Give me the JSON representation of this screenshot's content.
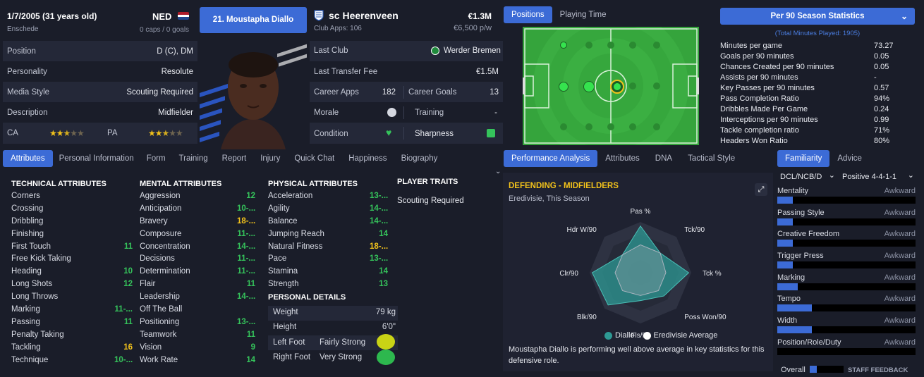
{
  "header": {
    "dob": "1/7/2005 (31 years old)",
    "birthplace": "Enschede",
    "nation": "NED",
    "caps": "0 caps / 0 goals",
    "player_button": "21. Moustapha Diallo",
    "club": "sc Heerenveen",
    "club_apps": "Club Apps: 106",
    "value": "€1.3M",
    "wage": "€6,500 p/w"
  },
  "profile": [
    {
      "label": "Position",
      "value": "D (C), DM"
    },
    {
      "label": "Personality",
      "value": "Resolute"
    },
    {
      "label": "Media Style",
      "value": "Scouting Required"
    },
    {
      "label": "Description",
      "value": "Midfielder"
    }
  ],
  "ca_label": "CA",
  "pa_label": "PA",
  "ca_stars": 2.5,
  "pa_stars": 2.5,
  "career": {
    "last_club_label": "Last Club",
    "last_club": "Werder Bremen",
    "transfer_fee_label": "Last Transfer Fee",
    "transfer_fee": "€1.5M",
    "career_apps_label": "Career Apps",
    "career_apps": "182",
    "career_goals_label": "Career Goals",
    "career_goals": "13",
    "morale_label": "Morale",
    "training_label": "Training",
    "training": "-",
    "condition_label": "Condition",
    "sharpness_label": "Sharpness"
  },
  "left_tabs": [
    "Attributes",
    "Personal Information",
    "Form",
    "Training",
    "Report",
    "Injury",
    "Quick Chat",
    "Happiness",
    "Biography"
  ],
  "technical": {
    "title": "TECHNICAL ATTRIBUTES",
    "rows": [
      {
        "name": "Corners",
        "value": ""
      },
      {
        "name": "Crossing",
        "value": ""
      },
      {
        "name": "Dribbling",
        "value": ""
      },
      {
        "name": "Finishing",
        "value": ""
      },
      {
        "name": "First Touch",
        "value": "11"
      },
      {
        "name": "Free Kick Taking",
        "value": ""
      },
      {
        "name": "Heading",
        "value": "10"
      },
      {
        "name": "Long Shots",
        "value": "12"
      },
      {
        "name": "Long Throws",
        "value": ""
      },
      {
        "name": "Marking",
        "value": "11-..."
      },
      {
        "name": "Passing",
        "value": "11"
      },
      {
        "name": "Penalty Taking",
        "value": ""
      },
      {
        "name": "Tackling",
        "value": "16"
      },
      {
        "name": "Technique",
        "value": "10-..."
      }
    ]
  },
  "mental": {
    "title": "MENTAL ATTRIBUTES",
    "rows": [
      {
        "name": "Aggression",
        "value": "12"
      },
      {
        "name": "Anticipation",
        "value": "10-..."
      },
      {
        "name": "Bravery",
        "value": "18-..."
      },
      {
        "name": "Composure",
        "value": "11-..."
      },
      {
        "name": "Concentration",
        "value": "14-..."
      },
      {
        "name": "Decisions",
        "value": "11-..."
      },
      {
        "name": "Determination",
        "value": "11-..."
      },
      {
        "name": "Flair",
        "value": "11"
      },
      {
        "name": "Leadership",
        "value": "14-..."
      },
      {
        "name": "Off The Ball",
        "value": ""
      },
      {
        "name": "Positioning",
        "value": "13-..."
      },
      {
        "name": "Teamwork",
        "value": "11"
      },
      {
        "name": "Vision",
        "value": "9"
      },
      {
        "name": "Work Rate",
        "value": "14"
      }
    ]
  },
  "physical": {
    "title": "PHYSICAL ATTRIBUTES",
    "rows": [
      {
        "name": "Acceleration",
        "value": "13-..."
      },
      {
        "name": "Agility",
        "value": "14-..."
      },
      {
        "name": "Balance",
        "value": "14-..."
      },
      {
        "name": "Jumping Reach",
        "value": "14"
      },
      {
        "name": "Natural Fitness",
        "value": "18-..."
      },
      {
        "name": "Pace",
        "value": "13-..."
      },
      {
        "name": "Stamina",
        "value": "14"
      },
      {
        "name": "Strength",
        "value": "13"
      }
    ]
  },
  "traits": {
    "title": "PLAYER TRAITS",
    "value": "Scouting Required"
  },
  "personal": {
    "title": "PERSONAL DETAILS",
    "weight_label": "Weight",
    "weight": "79 kg",
    "height_label": "Height",
    "height": "6'0\"",
    "left_foot_label": "Left Foot",
    "left_foot": "Fairly Strong",
    "right_foot_label": "Right Foot",
    "right_foot": "Very Strong"
  },
  "pitch_tabs": [
    "Positions",
    "Playing Time"
  ],
  "stats": {
    "dropdown": "Per 90 Season Statistics",
    "subtitle": "(Total Minutes Played: 1905)",
    "rows": [
      {
        "name": "Minutes per game",
        "value": "73.27"
      },
      {
        "name": "Goals per 90 minutes",
        "value": "0.05"
      },
      {
        "name": "Chances Created per 90 minutes",
        "value": "0.05"
      },
      {
        "name": "Assists per 90 minutes",
        "value": "-"
      },
      {
        "name": "Key Passes per 90 minutes",
        "value": "0.57"
      },
      {
        "name": "Pass Completion Ratio",
        "value": "94%"
      },
      {
        "name": "Dribbles Made Per Game",
        "value": "0.24"
      },
      {
        "name": "Interceptions per 90 minutes",
        "value": "0.99"
      },
      {
        "name": "Tackle completion ratio",
        "value": "71%"
      },
      {
        "name": "Headers Won Ratio",
        "value": "80%"
      }
    ]
  },
  "mid_tabs": [
    "Performance Analysis",
    "Attributes",
    "DNA",
    "Tactical Style"
  ],
  "analysis": {
    "title": "DEFENDING - MIDFIELDERS",
    "subtitle": "Eredivisie, This Season",
    "legend_player": "Diallo",
    "legend_avg": "Eredivisie Average",
    "summary": "Moustapha Diallo is performing well above average in key statistics for this defensive role."
  },
  "chart_data": {
    "type": "radar",
    "axes": [
      "Pas %",
      "Tck/90",
      "Tck %",
      "Poss Won/90",
      "Fls/90",
      "Blk/90",
      "Clr/90",
      "Hdr W/90"
    ],
    "series": [
      {
        "name": "Diallo",
        "values": [
          0.92,
          0.55,
          0.95,
          0.65,
          0.55,
          0.9,
          0.95,
          0.5
        ]
      },
      {
        "name": "Eredivisie Average",
        "values": [
          0.55,
          0.55,
          0.5,
          0.5,
          0.45,
          0.5,
          0.5,
          0.5
        ]
      }
    ]
  },
  "right_tabs": [
    "Familiarity",
    "Advice"
  ],
  "familiarity": {
    "position_select": "DCL/NCB/D",
    "formation_select": "Positive 4-4-1-1",
    "rows": [
      {
        "name": "Mentality",
        "level": "Awkward",
        "fill": 0.11
      },
      {
        "name": "Passing Style",
        "level": "Awkward",
        "fill": 0.11
      },
      {
        "name": "Creative Freedom",
        "level": "Awkward",
        "fill": 0.11
      },
      {
        "name": "Trigger Press",
        "level": "Awkward",
        "fill": 0.11
      },
      {
        "name": "Marking",
        "level": "Awkward",
        "fill": 0.15
      },
      {
        "name": "Tempo",
        "level": "Awkward",
        "fill": 0.25
      },
      {
        "name": "Width",
        "level": "Awkward",
        "fill": 0.25
      },
      {
        "name": "Position/Role/Duty",
        "level": "Awkward",
        "fill": 0
      }
    ],
    "overall_label": "Overall",
    "staff_feedback": "STAFF FEEDBACK"
  },
  "colors": {
    "accent": "#3c6bd6",
    "green": "#35c35b",
    "yellow": "#f2c21b",
    "pitch": "#3aa83f",
    "radar": "#2e9a94"
  }
}
